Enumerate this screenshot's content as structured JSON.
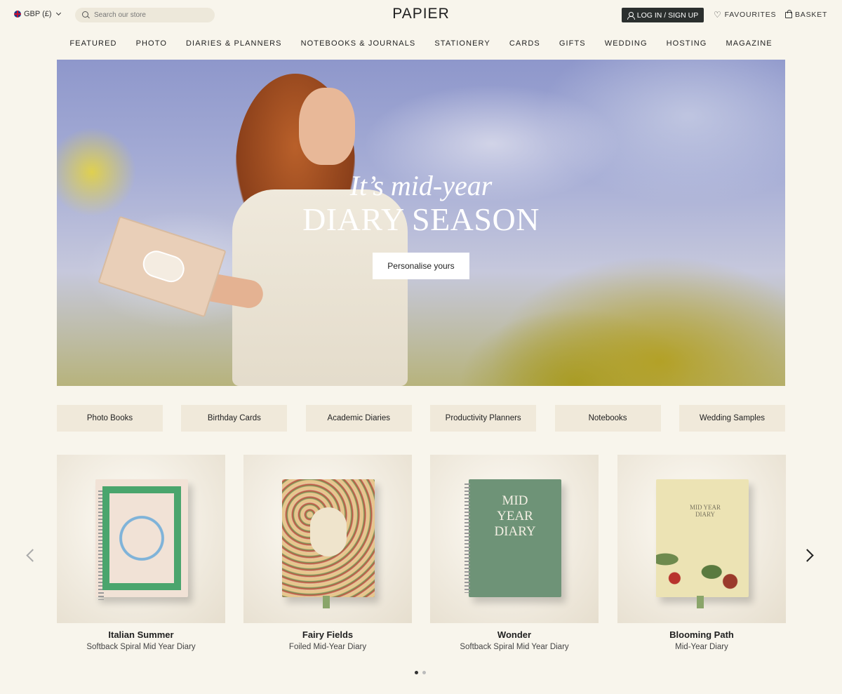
{
  "header": {
    "currency": "GBP (£)",
    "search_placeholder": "Search our store",
    "logo": "PAPIER",
    "login_label": "LOG IN / SIGN UP",
    "favourites_label": "FAVOURITES",
    "basket_label": "BASKET"
  },
  "nav": [
    "FEATURED",
    "PHOTO",
    "DIARIES & PLANNERS",
    "NOTEBOOKS & JOURNALS",
    "STATIONERY",
    "CARDS",
    "GIFTS",
    "WEDDING",
    "HOSTING",
    "MAGAZINE"
  ],
  "hero": {
    "line1": "It’s mid-year",
    "line2": "DIARY SEASON",
    "cta": "Personalise yours"
  },
  "categories": [
    "Photo Books",
    "Birthday Cards",
    "Academic Diaries",
    "Productivity Planners",
    "Notebooks",
    "Wedding Samples"
  ],
  "products": [
    {
      "name": "Italian Summer",
      "subtitle": "Softback Spiral Mid Year Diary"
    },
    {
      "name": "Fairy Fields",
      "subtitle": "Foiled Mid-Year Diary"
    },
    {
      "name": "Wonder",
      "subtitle": "Softback Spiral Mid Year Diary",
      "cover_text": "MID YEAR DIARY"
    },
    {
      "name": "Blooming Path",
      "subtitle": "Mid-Year Diary",
      "cover_text": "MID YEAR DIARY"
    }
  ],
  "carousel": {
    "page_count": 2,
    "active_page": 1
  },
  "colors": {
    "background": "#f8f5ec",
    "button_dark": "#2b2f2e",
    "chip_bg": "#f0e9da"
  }
}
